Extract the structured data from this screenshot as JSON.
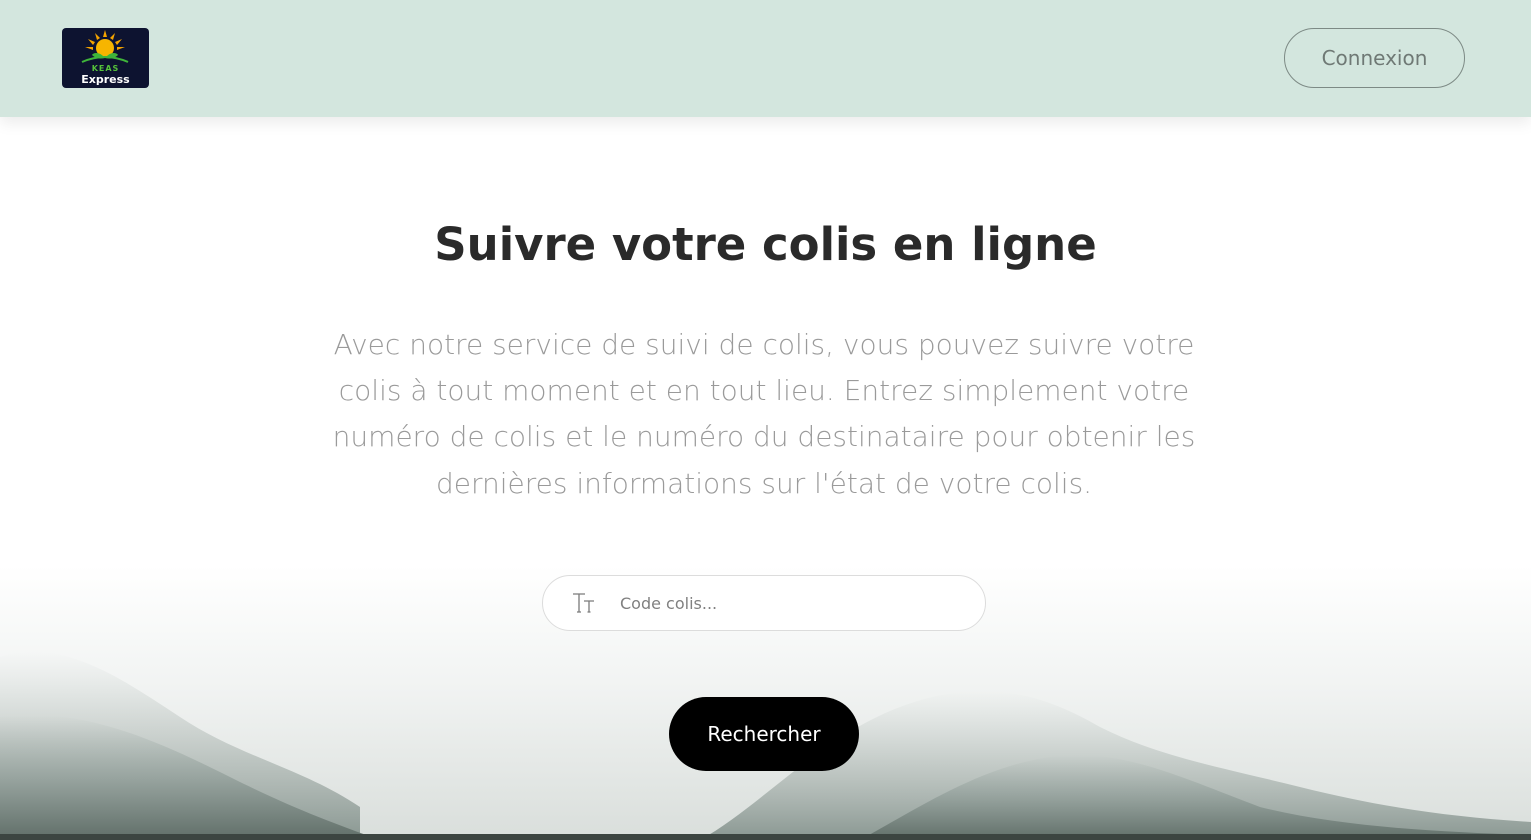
{
  "header": {
    "logo": {
      "line1": "KEAS",
      "line2": "Express",
      "icon": "sun-sprout-logo-icon"
    },
    "login_label": "Connexion"
  },
  "hero": {
    "title": "Suivre votre colis en ligne",
    "description": "Avec notre service de suivi de colis, vous pouvez suivre votre colis à tout moment et en tout lieu. Entrez simplement votre numéro de colis et le numéro du destinataire pour obtenir les dernières informations sur l'état de votre colis.",
    "search": {
      "placeholder": "Code colis...",
      "value": "",
      "icon": "text-format-icon"
    },
    "button_label": "Rechercher"
  },
  "colors": {
    "header_bg": "#d3e6de",
    "button_bg": "#000000",
    "logo_bg": "#0d1330",
    "logo_accent": "#55c23a"
  }
}
